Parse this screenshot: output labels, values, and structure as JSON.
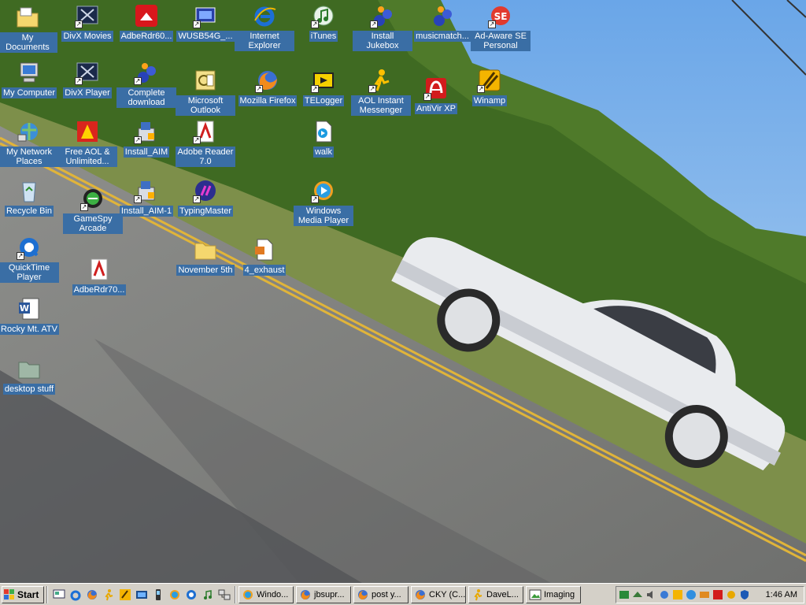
{
  "desktop": {
    "icons": [
      {
        "label": "My Documents"
      },
      {
        "label": "My Computer"
      },
      {
        "label": "My Network Places"
      },
      {
        "label": "Recycle Bin"
      },
      {
        "label": "QuickTime Player"
      },
      {
        "label": "Rocky Mt. ATV"
      },
      {
        "label": "desktop stuff"
      },
      {
        "label": "DivX Movies"
      },
      {
        "label": "DivX Player"
      },
      {
        "label": "Free AOL & Unlimited..."
      },
      {
        "label": "GameSpy Arcade"
      },
      {
        "label": "AdbeRdr70..."
      },
      {
        "label": "AdbeRdr60..."
      },
      {
        "label": "Complete download"
      },
      {
        "label": "Install_AIM"
      },
      {
        "label": "Install_AIM-1"
      },
      {
        "label": "WUSB54G_..."
      },
      {
        "label": "Microsoft Outlook"
      },
      {
        "label": "Adobe Reader 7.0"
      },
      {
        "label": "TypingMaster"
      },
      {
        "label": "November 5th"
      },
      {
        "label": "Internet Explorer"
      },
      {
        "label": "Mozilla Firefox"
      },
      {
        "label": "4_exhaust"
      },
      {
        "label": "iTunes"
      },
      {
        "label": "TELogger"
      },
      {
        "label": "walk"
      },
      {
        "label": "Windows Media Player"
      },
      {
        "label": "Install Jukebox"
      },
      {
        "label": "AOL Instant Messenger"
      },
      {
        "label": "musicmatch..."
      },
      {
        "label": "AntiVir XP"
      },
      {
        "label": "Ad-Aware SE Personal"
      },
      {
        "label": "Winamp"
      }
    ]
  },
  "taskbar": {
    "start_label": "Start",
    "quick_launch": [
      "show-desktop-icon",
      "internet-explorer-icon",
      "firefox-icon",
      "aim-icon",
      "winamp-icon",
      "media-icon",
      "phone-icon",
      "windows-media-icon",
      "quicktime-icon",
      "itunes-icon",
      "network-icon"
    ],
    "tasks": [
      "Windo...",
      "jbsupr...",
      "post y...",
      "CKY (C...",
      "DaveL...",
      "Imaging"
    ],
    "clock": "1:46 AM"
  }
}
